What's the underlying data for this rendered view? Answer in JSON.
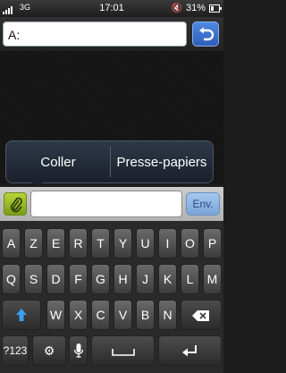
{
  "status_bar": {
    "network": "3G",
    "time": "17:01",
    "battery": "31%"
  },
  "address": {
    "value": "A:"
  },
  "popup": {
    "paste": "Coller",
    "clipboard": "Presse-papiers"
  },
  "compose": {
    "send": "Env.",
    "message": ""
  },
  "keyboard": {
    "row1": [
      "A",
      "Z",
      "E",
      "R",
      "T",
      "Y",
      "U",
      "I",
      "O",
      "P"
    ],
    "row2": [
      "Q",
      "S",
      "D",
      "F",
      "G",
      "H",
      "J",
      "K",
      "L",
      "M"
    ],
    "row3": [
      "W",
      "X",
      "C",
      "V",
      "B",
      "N"
    ],
    "symbols": "?123"
  },
  "colors": {
    "accent": "#2f5fb8",
    "attach": "#8fb022",
    "send": "#7aa4d8"
  }
}
